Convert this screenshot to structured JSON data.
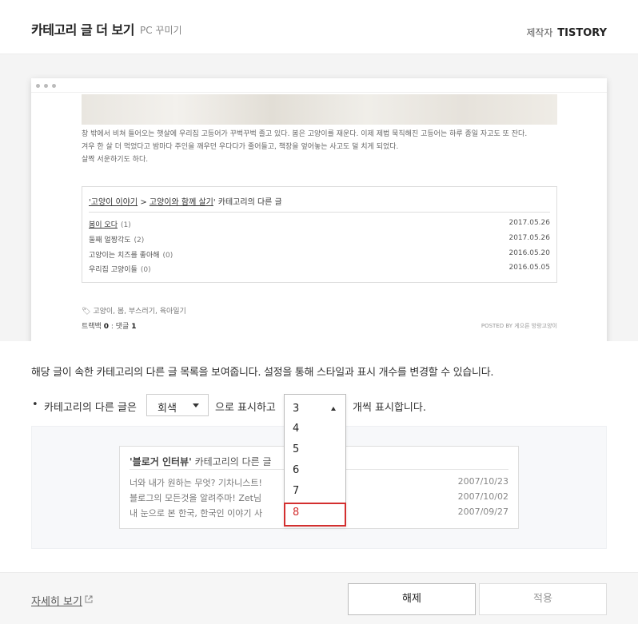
{
  "header": {
    "title": "카테고리 글 더 보기",
    "subtitle": "PC 꾸미기",
    "maker_label": "제작자",
    "maker_name": "TISTORY"
  },
  "preview": {
    "post_lines": [
      "창 밖에서 비쳐 들어오는 햇살에 우리집 고등어가 꾸벅꾸벅 졸고 있다. 봄은 고양이를 재운다. 이제 제법 묵직해진 고등어는 하루 종일 자고도 또 잔다.",
      "겨우 한 살 더 먹었다고 밤마다 주인을 깨우던 우다다가 줄어들고, 책장을 엎어놓는 사고도 덜 치게 되었다.",
      "살짝 서운하기도 하다."
    ],
    "related_title_a": "'고양이 이야기",
    "related_title_sep": " > ",
    "related_title_b": "고양이와 함께 살기",
    "related_title_rest": "' 카테고리의 다른 글",
    "items": [
      {
        "title": "봄이 오다",
        "count": "(1)",
        "date": "2017.05.26"
      },
      {
        "title": "둘째 얼짱각도",
        "count": "(2)",
        "date": "2017.05.26"
      },
      {
        "title": "고양이는 치즈를 좋아해",
        "count": "(0)",
        "date": "2016.05.20"
      },
      {
        "title": "우리집 고양이들",
        "count": "(0)",
        "date": "2016.05.05"
      }
    ],
    "tags": "고양이, 봄, 부스러기, 육아일기",
    "trackback_label": "트랙백",
    "trackback_count": "0",
    "comment_label": "댓글",
    "comment_count": "1",
    "posted_by": "POSTED BY 게으른 방랑고양이"
  },
  "description": "해당 글이 속한 카테고리의 다른 글 목록을 보여줍니다. 설정을 통해 스타일과 표시 개수를 변경할 수 있습니다.",
  "option": {
    "bullet": "•",
    "prefix": "카테고리의 다른 글은",
    "style_value": "회색",
    "middle": "으로 표시하고",
    "suffix": "개씩 표시합니다.",
    "count_value": "3",
    "count_options": [
      "4",
      "5",
      "6",
      "7",
      "8"
    ],
    "highlighted": "8"
  },
  "example": {
    "title_quoted": "'블로거 인터뷰'",
    "title_rest": " 카테고리의 다른 글",
    "rows": [
      {
        "title": "너와 내가 원하는 무엇? 기차니스트!",
        "date": "2007/10/23"
      },
      {
        "title": "블로그의 모든것을 알려주마! Zet님",
        "date": "2007/10/02"
      },
      {
        "title": "내 눈으로 본 한국, 한국인 이야기 사",
        "date": "2007/09/27"
      }
    ]
  },
  "footer": {
    "more_label": "자세히 보기",
    "cancel_label": "해제",
    "apply_label": "적용"
  },
  "colors": {
    "highlight": "#d32f2f",
    "preview_bg": "#f4f4f4",
    "footer_bg": "#f6f6f6"
  }
}
